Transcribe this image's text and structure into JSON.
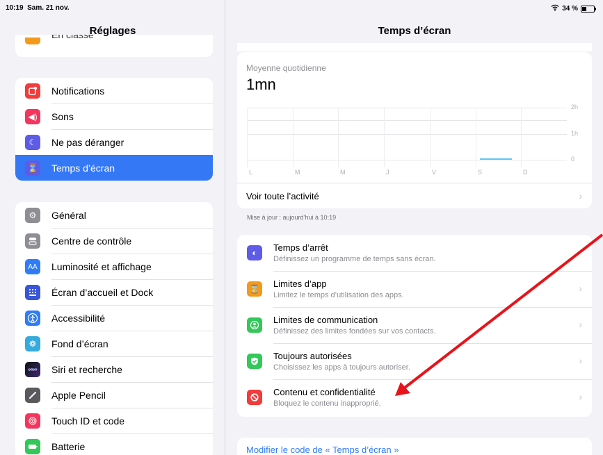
{
  "status": {
    "time": "10:19",
    "date": "Sam. 21 nov.",
    "battery": "34 %",
    "battery_level": 0.34
  },
  "sidebar": {
    "title": "Réglages",
    "partial_item": "En classe",
    "group1": [
      {
        "label": "Notifications",
        "icon": "notifications-icon",
        "color": "#f23b3b"
      },
      {
        "label": "Sons",
        "icon": "sound-icon",
        "color": "#f2365e"
      },
      {
        "label": "Ne pas déranger",
        "icon": "moon-icon",
        "color": "#5e5ce6"
      },
      {
        "label": "Temps d’écran",
        "icon": "hourglass-icon",
        "color": "#5e5ce6",
        "selected": true
      }
    ],
    "group2": [
      {
        "label": "Général",
        "icon": "gear-icon",
        "color": "#8e8e93"
      },
      {
        "label": "Centre de contrôle",
        "icon": "toggles-icon",
        "color": "#8e8e93"
      },
      {
        "label": "Luminosité et affichage",
        "icon": "display-icon",
        "glyph": "AA",
        "color": "#2f7cf6"
      },
      {
        "label": "Écran d’accueil et Dock",
        "icon": "home-screen-icon",
        "color": "#3a55d6"
      },
      {
        "label": "Accessibilité",
        "icon": "accessibility-icon",
        "color": "#2f7cf6"
      },
      {
        "label": "Fond d’écran",
        "icon": "wallpaper-icon",
        "color": "#35aadc"
      },
      {
        "label": "Siri et recherche",
        "icon": "siri-icon",
        "color": "#222244"
      },
      {
        "label": "Apple Pencil",
        "icon": "pencil-icon",
        "color": "#5a5a5e"
      },
      {
        "label": "Touch ID et code",
        "icon": "fingerprint-icon",
        "color": "#f2365e"
      },
      {
        "label": "Batterie",
        "icon": "battery-icon",
        "color": "#34c759"
      }
    ]
  },
  "main": {
    "title": "Temps d’écran",
    "avg_label": "Moyenne quotidienne",
    "avg_value": "1mn",
    "chart_y_ticks": [
      "2h",
      "1h",
      "0"
    ],
    "chart_days": [
      "L",
      "M",
      "M",
      "J",
      "V",
      "S",
      "D"
    ],
    "chart_usage_minutes": [
      0,
      0,
      0,
      0,
      0,
      1,
      0
    ],
    "all_activity": "Voir toute l’activité",
    "updated": "Mise à jour : aujourd’hui à 10:19",
    "limits": [
      {
        "title": "Temps d’arrêt",
        "subtitle": "Définissez un programme de temps sans écran.",
        "icon": "downtime-icon",
        "color": "#5e5ce6"
      },
      {
        "title": "Limites d’app",
        "subtitle": "Limitez le temps d’utilisation des apps.",
        "icon": "hourglass-icon",
        "color": "#f29a1c"
      },
      {
        "title": "Limites de communication",
        "subtitle": "Définissez des limites fondées sur vos contacts.",
        "icon": "person-icon",
        "color": "#34c759"
      },
      {
        "title": "Toujours autorisées",
        "subtitle": "Choisissez les apps à toujours autoriser.",
        "icon": "checkmark-icon",
        "color": "#34c759"
      },
      {
        "title": "Contenu et confidentialité",
        "subtitle": "Bloquez le contenu inapproprié.",
        "icon": "restricted-icon",
        "color": "#f23b3b"
      }
    ],
    "change_code": "Modifier le code de « Temps d’écran »"
  },
  "colors": {
    "accent": "#3478f6",
    "annotation_arrow": "#e8141b"
  }
}
